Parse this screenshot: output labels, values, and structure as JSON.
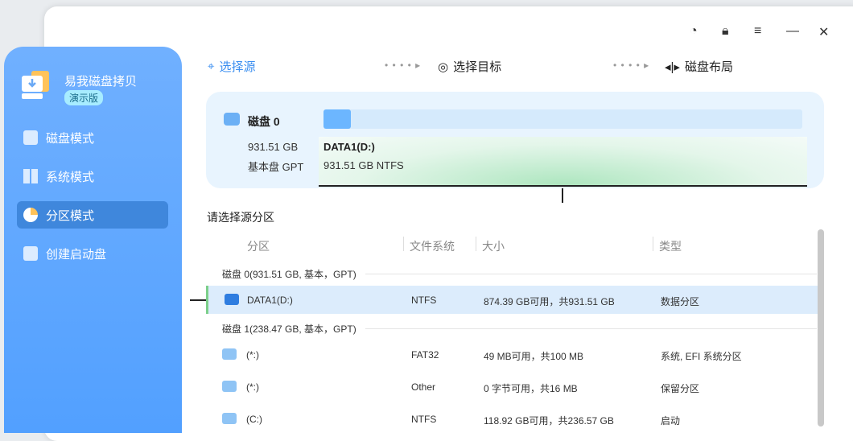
{
  "app": {
    "name": "易我磁盘拷贝",
    "badge": "演示版"
  },
  "sidebar": {
    "items": [
      {
        "label": "磁盘模式"
      },
      {
        "label": "系统模式"
      },
      {
        "label": "分区模式"
      },
      {
        "label": "创建启动盘"
      }
    ]
  },
  "steps": {
    "source": "选择源",
    "target": "选择目标",
    "layout": "磁盘布局"
  },
  "disk": {
    "name": "磁盘 0",
    "size": "931.51 GB",
    "type": "基本盘 GPT",
    "partition": {
      "name": "DATA1(D:)",
      "detail": "931.51 GB NTFS"
    }
  },
  "section_title": "请选择源分区",
  "table": {
    "headers": [
      "分区",
      "文件系统",
      "大小",
      "类型"
    ],
    "groups": [
      {
        "label": "磁盘 0(931.51 GB, 基本，GPT)",
        "rows": [
          {
            "name": "DATA1(D:)",
            "fs": "NTFS",
            "size": "874.39 GB可用，共931.51 GB",
            "type": "数据分区"
          }
        ]
      },
      {
        "label": "磁盘 1(238.47 GB, 基本，GPT)",
        "rows": [
          {
            "name": "(*:)",
            "fs": "FAT32",
            "size": "49 MB可用，共100 MB",
            "type": "系统, EFI 系统分区"
          },
          {
            "name": "(*:)",
            "fs": "Other",
            "size": "0 字节可用，共16 MB",
            "type": "保留分区"
          },
          {
            "name": "(C:)",
            "fs": "NTFS",
            "size": "118.92 GB可用，共236.57 GB",
            "type": "启动"
          }
        ]
      }
    ]
  },
  "colors": {
    "accent": "#4a9dff",
    "selected": "#dcecfc"
  }
}
